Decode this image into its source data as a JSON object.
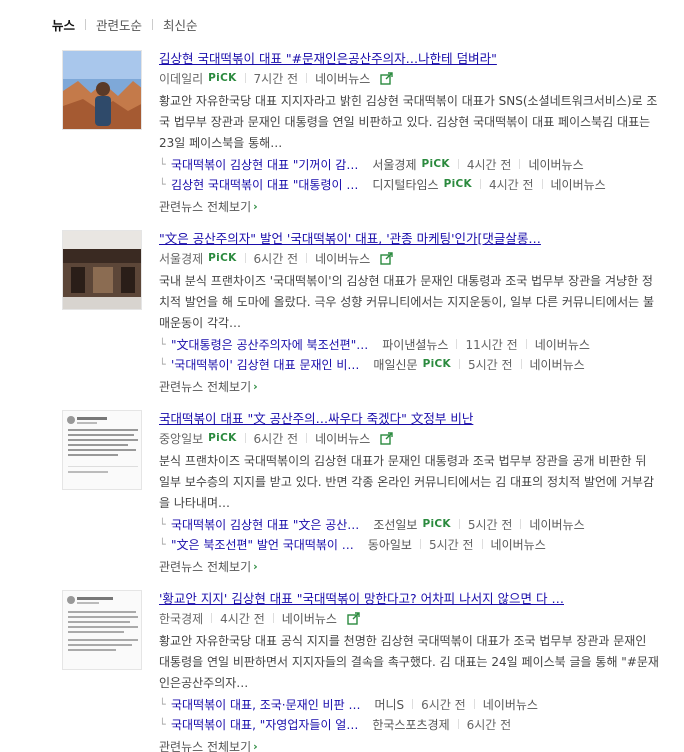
{
  "sort": {
    "tabs": [
      "뉴스",
      "관련도순",
      "최신순"
    ]
  },
  "common": {
    "pick": "PiCK",
    "more": "관련뉴스 전체보기",
    "more_chevron": "›",
    "ext_icon": "share-link-icon"
  },
  "items": [
    {
      "title": "김상현 국대떡볶이 대표 \"#문재인은공산주의자…나한테 덤벼라\"",
      "source": "이데일리",
      "pick": true,
      "time": "7시간 전",
      "naver": "네이버뉴스",
      "desc": "황교안 자유한국당 대표 지지자라고 밝힌 김상현 국대떡볶이 대표가 SNS(소셜네트워크서비스)로 조국 법무부 장관과 문재인 대통령을 연일 비판하고 있다. 김상현 국대떡볶이 대표 페이스북김 대표는 23일 페이스북을 통해…",
      "related": [
        {
          "title": "국대떡볶이 김상현 대표 \"기꺼이 감…",
          "source": "서울경제",
          "pick": true,
          "time": "4시간 전",
          "naver": "네이버뉴스"
        },
        {
          "title": "김상현 국대떡볶이 대표 \"대통령이 …",
          "source": "디지털타임스",
          "pick": true,
          "time": "4시간 전",
          "naver": "네이버뉴스"
        }
      ]
    },
    {
      "title": "\"文은 공산주의자\" 발언 '국대떡볶이' 대표, '관종 마케팅'인가[댓글살롱…",
      "source": "서울경제",
      "pick": true,
      "time": "6시간 전",
      "naver": "네이버뉴스",
      "desc": "국내 분식 프랜차이즈 '국대떡볶이'의 김상현 대표가 문재인 대통령과 조국 법무부 장관을 겨냥한 정치적 발언을 해 도마에 올랐다. 극우 성향 커뮤니티에서는 지지운동이, 일부 다른 커뮤니티에서는 불매운동이 각각…",
      "related": [
        {
          "title": "\"文대통령은 공산주의자에 북조선편\"…",
          "source": "파이낸셜뉴스",
          "pick": false,
          "time": "11시간 전",
          "naver": "네이버뉴스"
        },
        {
          "title": "'국대떡볶이' 김상현 대표 문재인 비…",
          "source": "매일신문",
          "pick": true,
          "time": "5시간 전",
          "naver": "네이버뉴스"
        }
      ]
    },
    {
      "title": "국대떡볶이 대표 \"文 공산주의…싸우다 죽겠다\" 文정부 비난",
      "source": "중앙일보",
      "pick": true,
      "time": "6시간 전",
      "naver": "네이버뉴스",
      "desc": "분식 프랜차이즈 국대떡볶이의 김상현 대표가 문재인 대통령과 조국 법무부 장관을 공개 비판한 뒤 일부 보수층의 지지를 받고 있다. 반면 각종 온라인 커뮤니티에서는 김 대표의 정치적 발언에 거부감을 나타내며…",
      "related": [
        {
          "title": "국대떡볶이 김상현 대표 \"文은 공산…",
          "source": "조선일보",
          "pick": true,
          "time": "5시간 전",
          "naver": "네이버뉴스"
        },
        {
          "title": "\"文은 북조선편\" 발언 국대떡볶이 …",
          "source": "동아일보",
          "pick": false,
          "time": "5시간 전",
          "naver": "네이버뉴스"
        }
      ]
    },
    {
      "title": "'황교안 지지' 김상현 대표 \"국대떡볶이 망한다고? 어차피 나서지 않으면 다 …",
      "source": "한국경제",
      "pick": false,
      "time": "4시간 전",
      "naver": "네이버뉴스",
      "desc": "황교안 자유한국당 대표 공식 지지를 천명한 김상현 국대떡볶이 대표가 조국 법무부 장관과 문재인 대통령을 연일 비판하면서 지지자들의 결속을 촉구했다. 김 대표는 24일 페이스북 글을 통해 \"#문재인은공산주의자…",
      "related": [
        {
          "title": "국대떡볶이 대표, 조국·문재인 비판 …",
          "source": "머니S",
          "pick": false,
          "time": "6시간 전",
          "naver": "네이버뉴스"
        },
        {
          "title": "국대떡볶이 대표, \"자영업자들이 얼…",
          "source": "한국스포츠경제",
          "pick": false,
          "time": "6시간 전",
          "naver": ""
        }
      ]
    }
  ]
}
